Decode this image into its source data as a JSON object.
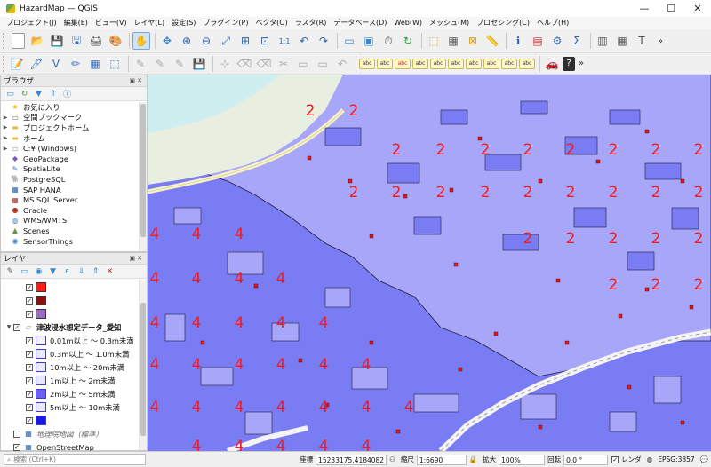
{
  "window": {
    "title": "HazardMap — QGIS"
  },
  "menu": [
    "プロジェクト(J)",
    "編集(E)",
    "ビュー(V)",
    "レイヤ(L)",
    "設定(S)",
    "プラグイン(P)",
    "ベクタ(O)",
    "ラスタ(R)",
    "データベース(D)",
    "Web(W)",
    "メッシュ(M)",
    "プロセシング(C)",
    "ヘルプ(H)"
  ],
  "browser": {
    "title": "ブラウザ",
    "items": [
      {
        "label": "お気に入り",
        "icon": "star-icon",
        "glyph": "★",
        "color": "#e6b800",
        "exp": ""
      },
      {
        "label": "空間ブックマーク",
        "icon": "bookmark-icon",
        "glyph": "▭",
        "color": "#6a6a6a",
        "exp": "▶"
      },
      {
        "label": "プロジェクトホーム",
        "icon": "folder-icon",
        "glyph": "▬",
        "color": "#e8b84a",
        "exp": "▶"
      },
      {
        "label": "ホーム",
        "icon": "folder-icon",
        "glyph": "▬",
        "color": "#e8b84a",
        "exp": "▶"
      },
      {
        "label": "C:¥ (Windows)",
        "icon": "drive-icon",
        "glyph": "▭",
        "color": "#8b8b8b",
        "exp": "▶"
      },
      {
        "label": "GeoPackage",
        "icon": "geopackage-icon",
        "glyph": "◆",
        "color": "#7a5bbd",
        "exp": ""
      },
      {
        "label": "SpatiaLite",
        "icon": "spatialite-icon",
        "glyph": "✎",
        "color": "#3a6fbf",
        "exp": ""
      },
      {
        "label": "PostgreSQL",
        "icon": "postgresql-icon",
        "glyph": "🐘",
        "color": "#336791",
        "exp": ""
      },
      {
        "label": "SAP HANA",
        "icon": "sap-hana-icon",
        "glyph": "▦",
        "color": "#2a62b0",
        "exp": ""
      },
      {
        "label": "MS SQL Server",
        "icon": "mssql-icon",
        "glyph": "▦",
        "color": "#a83030",
        "exp": ""
      },
      {
        "label": "Oracle",
        "icon": "oracle-icon",
        "glyph": "●",
        "color": "#c0392b",
        "exp": ""
      },
      {
        "label": "WMS/WMTS",
        "icon": "globe-icon",
        "glyph": "◍",
        "color": "#3a87c8",
        "exp": ""
      },
      {
        "label": "Scenes",
        "icon": "scenes-icon",
        "glyph": "▲",
        "color": "#6a9a3a",
        "exp": ""
      },
      {
        "label": "SensorThings",
        "icon": "sensor-icon",
        "glyph": "◉",
        "color": "#3a87c8",
        "exp": ""
      }
    ]
  },
  "layers": {
    "title": "レイヤ",
    "top_swatches": [
      "#ff1a1a",
      "#8b1010",
      "#9b6bc9"
    ],
    "group": "津波浸水想定データ_愛知",
    "legend": [
      {
        "label": "0.01m以上 ～ 0.3m未満",
        "color": "#f2f2ff"
      },
      {
        "label": "0.3m以上 ～ 1.0m未満",
        "color": "#e8e8ff"
      },
      {
        "label": "10m以上 ～ 20m未満",
        "color": "#e8e8ff"
      },
      {
        "label": "1m以上 ～ 2m未満",
        "color": "#e8e8ff"
      },
      {
        "label": "2m以上 ～ 5m未満",
        "color": "#6b5ef0"
      },
      {
        "label": "5m以上 ～ 10m未満",
        "color": "#e8e8ff"
      },
      {
        "label": "",
        "color": "#1a1ae6"
      }
    ],
    "bottom": [
      {
        "label": "地理院地図（標準）",
        "checked": false
      },
      {
        "label": "OpenStreetMap",
        "checked": true
      }
    ]
  },
  "map": {
    "label_light": "2",
    "label_dark": "4",
    "colors": {
      "light": "#a7a6f8",
      "dark": "#7a7cf3",
      "label": "#ee1c24",
      "land": "#e9efe0",
      "river": "#cfeef0"
    }
  },
  "status": {
    "search_placeholder": "検索 (Ctrl+K)",
    "coord_label": "座標",
    "coord_value": "15233175,4184082",
    "scale_label": "縮尺",
    "scale_value": "1:6690",
    "zoom_label": "拡大",
    "zoom_value": "100%",
    "rotation_label": "回転",
    "rotation_value": "0.0 °",
    "render_label": "レンダ",
    "crs": "EPSG:3857"
  },
  "icons": {
    "toolbar1": [
      "new-project-icon",
      "open-project-icon",
      "save-project-icon",
      "save-as-icon",
      "print-layout-icon",
      "style-manager-icon",
      "pan-icon",
      "pan-to-selection-icon",
      "zoom-in-icon",
      "zoom-out-icon",
      "zoom-full-icon",
      "zoom-selection-icon",
      "zoom-layer-icon",
      "zoom-native-icon",
      "zoom-last-icon",
      "zoom-next-icon",
      "new-map-view-icon",
      "new-3d-view-icon",
      "temporal-icon",
      "refresh-icon",
      "select-icon",
      "attribute-table-icon",
      "deselect-icon",
      "measure-icon",
      "identify-icon",
      "calculator-icon",
      "settings-icon",
      "sum-icon",
      "stats-icon",
      "toolbox-icon",
      "text-annotation-icon"
    ],
    "toolbar2": [
      "digitize-1-icon",
      "digitize-2-icon",
      "digitize-3-icon",
      "digitize-4-icon",
      "digitize-5-icon",
      "digitize-6-icon",
      "digitize-7-icon",
      "digitize-8-icon",
      "digitize-9-icon",
      "digitize-10-icon",
      "digitize-11-icon",
      "digitize-12-icon",
      "digitize-13-icon",
      "digitize-14-icon",
      "digitize-15-icon",
      "digitize-16-icon",
      "digitize-17-icon",
      "label-1-icon",
      "label-2-icon",
      "label-3-icon",
      "label-4-icon",
      "label-5-icon",
      "label-6-icon",
      "label-7-icon",
      "label-8-icon",
      "label-9-icon",
      "label-10-icon",
      "label-11-icon",
      "help-icon"
    ]
  }
}
